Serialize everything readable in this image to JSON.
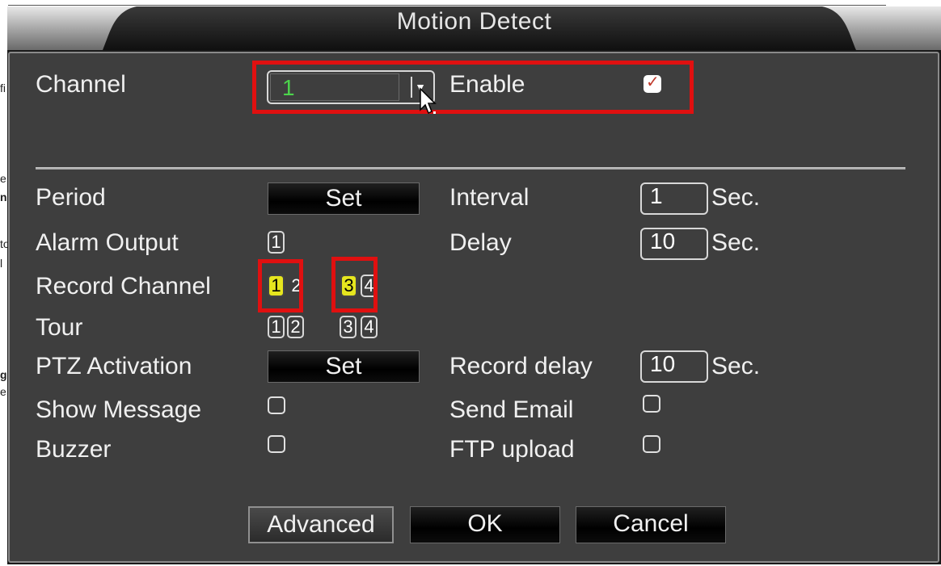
{
  "background_fragments": [
    "fi",
    "e",
    "na",
    "to",
    "l",
    "g",
    "e"
  ],
  "dialog": {
    "title": "Motion Detect"
  },
  "channel": {
    "label": "Channel",
    "value": "1",
    "enable_label": "Enable",
    "enable_checked": true
  },
  "rows": {
    "period_label": "Period",
    "period_button": "Set",
    "interval_label": "Interval",
    "interval_value": "1",
    "interval_unit": "Sec.",
    "alarm_output_label": "Alarm Output",
    "alarm_output_numbers": [
      "1"
    ],
    "delay_label": "Delay",
    "delay_value": "10",
    "delay_unit": "Sec.",
    "record_channel_label": "Record Channel",
    "record_channel_numbers": [
      "1",
      "2",
      "3",
      "4"
    ],
    "record_channel_selected": [
      "1",
      "3"
    ],
    "tour_label": "Tour",
    "tour_numbers": [
      "1",
      "2",
      "3",
      "4"
    ],
    "ptz_label": "PTZ Activation",
    "ptz_button": "Set",
    "record_delay_label": "Record delay",
    "record_delay_value": "10",
    "record_delay_unit": "Sec.",
    "show_message_label": "Show Message",
    "show_message_checked": false,
    "send_email_label": "Send Email",
    "send_email_checked": false,
    "buzzer_label": "Buzzer",
    "buzzer_checked": false,
    "ftp_upload_label": "FTP upload",
    "ftp_upload_checked": false
  },
  "buttons": {
    "advanced": "Advanced",
    "ok": "OK",
    "cancel": "Cancel"
  },
  "colors": {
    "highlight": "#e01010",
    "selected_channel": "#e6e61e",
    "channel_value": "#4cd44c",
    "check_mark": "#c0392b"
  },
  "icons": {
    "dropdown": "chevron-down-icon",
    "cursor": "mouse-pointer-icon",
    "check": "checkmark-icon"
  }
}
